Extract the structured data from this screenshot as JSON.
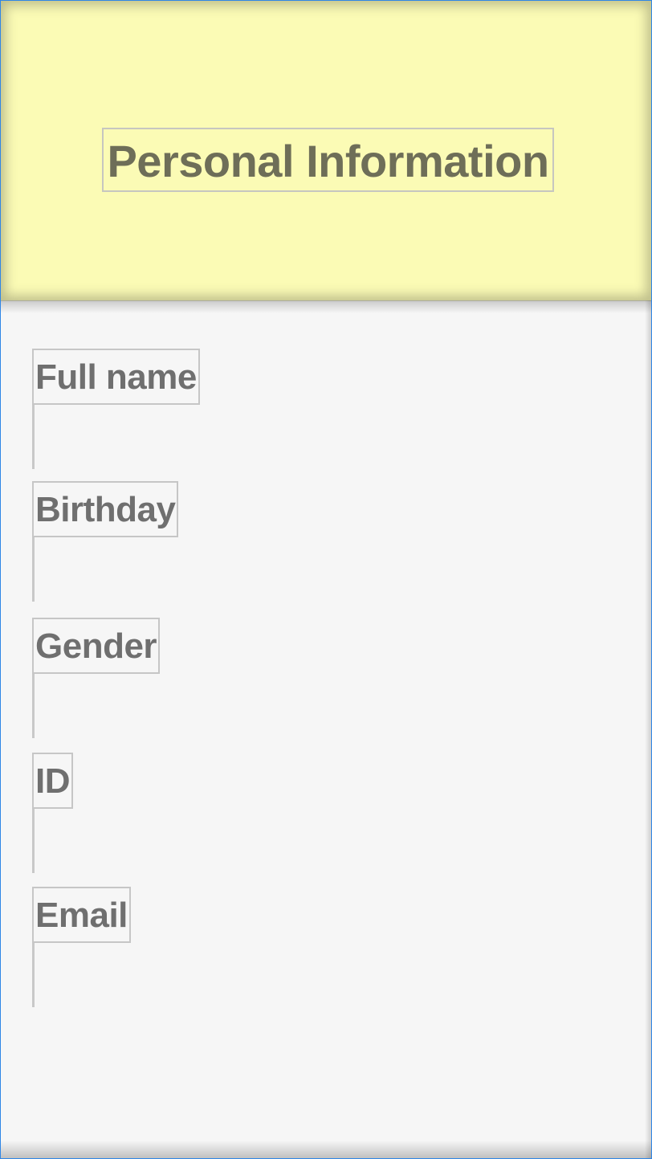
{
  "header": {
    "title": "Personal Information"
  },
  "form": {
    "fields": [
      {
        "label": "Full name"
      },
      {
        "label": "Birthday"
      },
      {
        "label": "Gender"
      },
      {
        "label": "ID"
      },
      {
        "label": "Email"
      }
    ]
  },
  "colors": {
    "header_background": "#fbfbb5",
    "header_text": "#6e6e58",
    "body_background": "#f6f6f6",
    "label_text": "#6f6f6f",
    "frame_border": "#2f86e6"
  }
}
